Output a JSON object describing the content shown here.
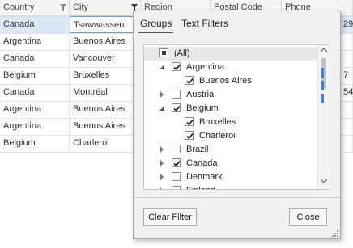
{
  "grid": {
    "columns": [
      "Country",
      "City",
      "Region",
      "Postal Code",
      "Phone"
    ],
    "rows": [
      {
        "country": "Canada",
        "city": "Tsawwassen",
        "tail": "29",
        "selected": true
      },
      {
        "country": "Argentina",
        "city": "Buenos Aires",
        "tail": ""
      },
      {
        "country": "Canada",
        "city": "Vancouver",
        "tail": ""
      },
      {
        "country": "Belgium",
        "city": "Bruxelles",
        "tail": "7"
      },
      {
        "country": "Canada",
        "city": "Montréal",
        "tail": "54"
      },
      {
        "country": "Argentina",
        "city": "Buenos Aires",
        "tail": ""
      },
      {
        "country": "Argentina",
        "city": "Buenos Aires",
        "tail": ""
      },
      {
        "country": "Belgium",
        "city": "Charleroi",
        "tail": ""
      }
    ]
  },
  "popup": {
    "tabs": [
      "Groups",
      "Text Filters"
    ],
    "active_tab": "Groups",
    "items": [
      {
        "label": "(All)",
        "level": 0,
        "state": "indeterminate",
        "expander": "none"
      },
      {
        "label": "Argentina",
        "level": 0,
        "state": "checked",
        "expander": "expanded"
      },
      {
        "label": "Buenos Aires",
        "level": 1,
        "state": "checked",
        "expander": "none"
      },
      {
        "label": "Austria",
        "level": 0,
        "state": "unchecked",
        "expander": "collapsed"
      },
      {
        "label": "Belgium",
        "level": 0,
        "state": "checked",
        "expander": "expanded"
      },
      {
        "label": "Bruxelles",
        "level": 1,
        "state": "checked",
        "expander": "none"
      },
      {
        "label": "Charleroi",
        "level": 1,
        "state": "checked",
        "expander": "none"
      },
      {
        "label": "Brazil",
        "level": 0,
        "state": "unchecked",
        "expander": "collapsed"
      },
      {
        "label": "Canada",
        "level": 0,
        "state": "checked",
        "expander": "collapsed"
      },
      {
        "label": "Denmark",
        "level": 0,
        "state": "unchecked",
        "expander": "collapsed"
      },
      {
        "label": "Finland",
        "level": 0,
        "state": "unchecked",
        "expander": "collapsed"
      }
    ],
    "clear_filter_label": "Clear Filter",
    "close_label": "Close"
  },
  "colors": {
    "check": "#1a1a1a",
    "selected_row": "#dce8f5",
    "scroll_accent": "#4a7cc9"
  }
}
